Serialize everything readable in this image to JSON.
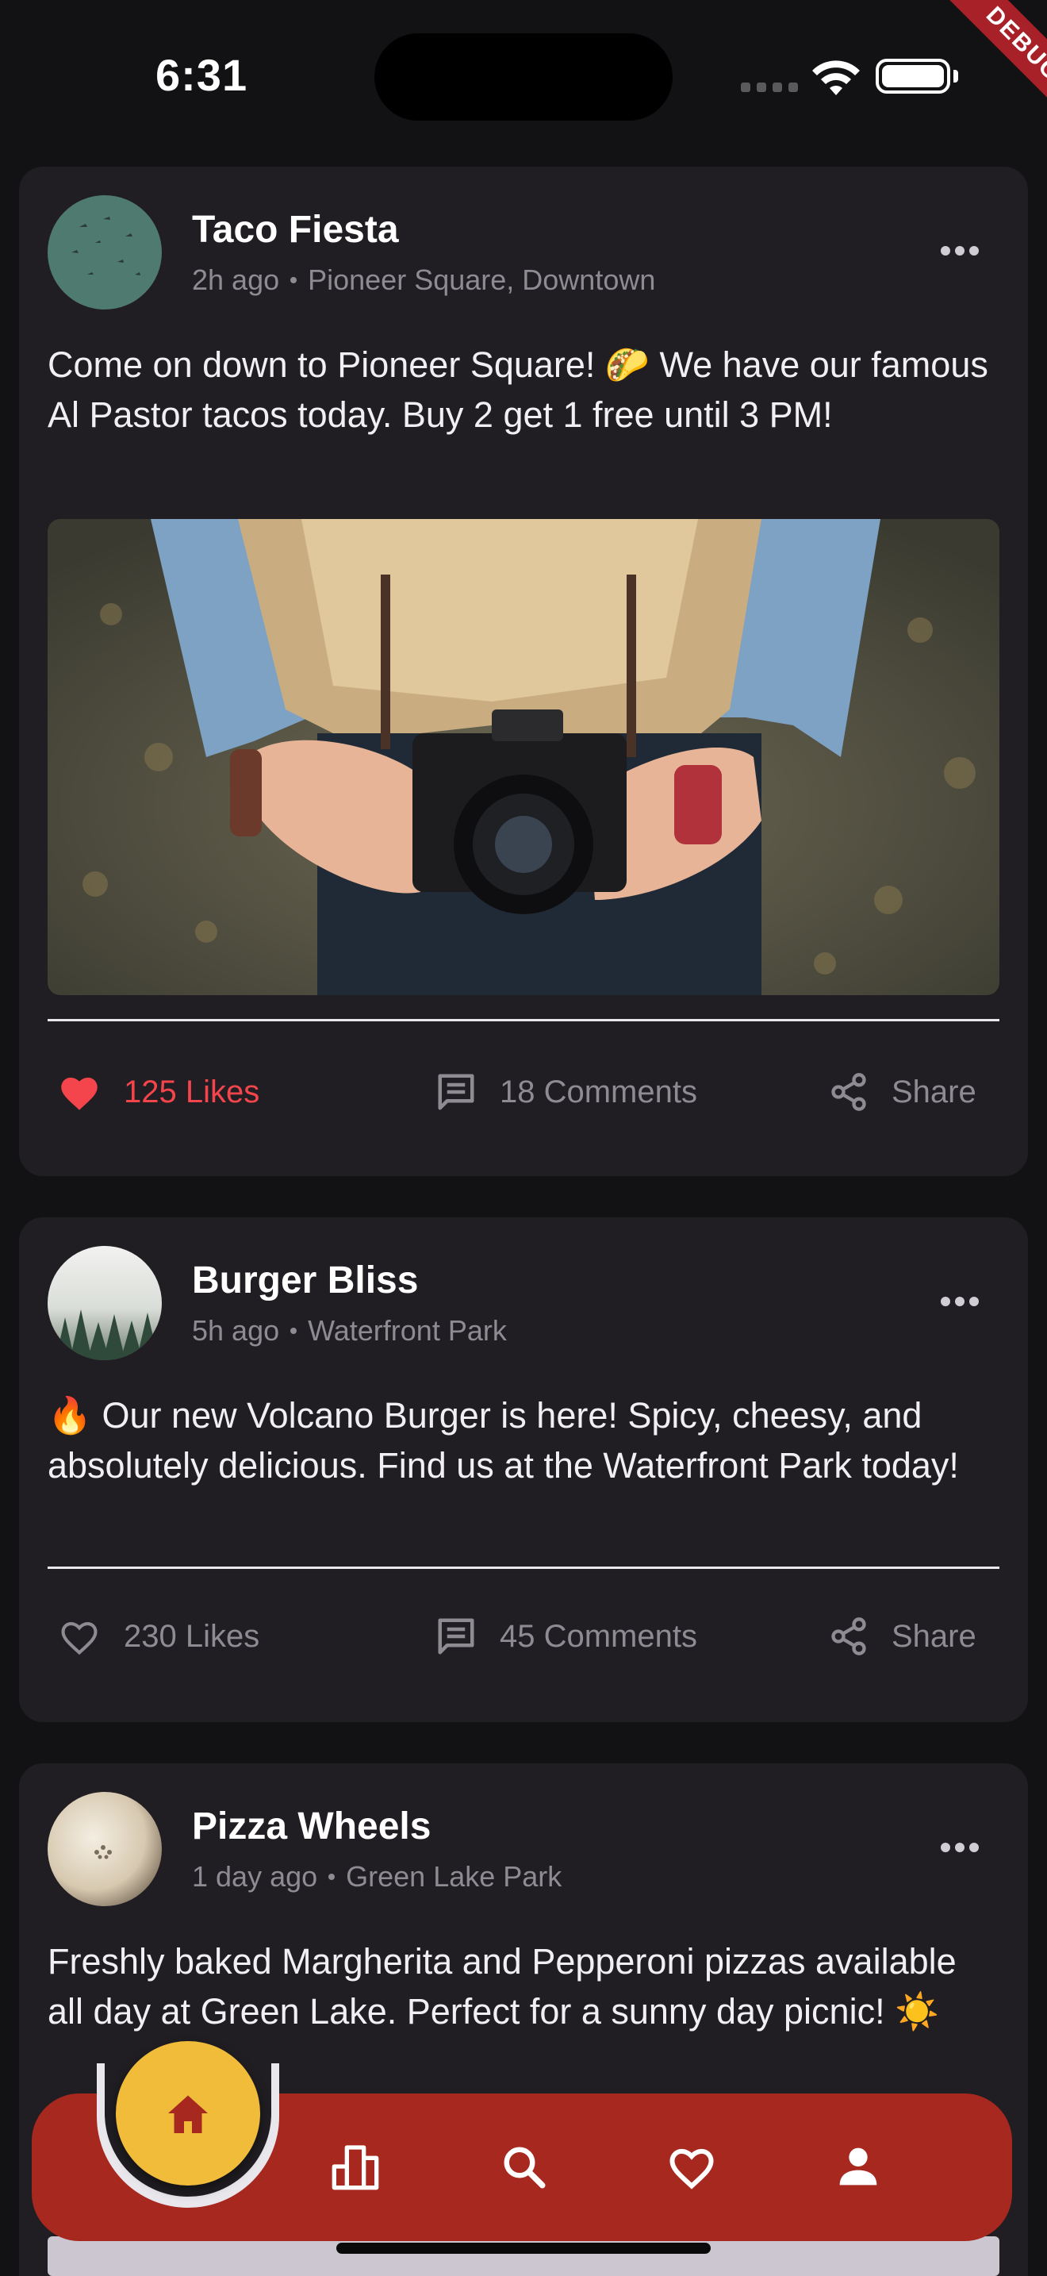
{
  "status_bar": {
    "time": "6:31",
    "debug_label": "DEBUG"
  },
  "colors": {
    "background": "#121113",
    "card": "#201e22",
    "accent_like": "#f4454c",
    "nav_bar": "#a7281f",
    "fab": "#f0bc3a",
    "muted_text": "#8e8b92"
  },
  "posts": [
    {
      "author": "Taco Fiesta",
      "time_ago": "2h ago",
      "location": "Pioneer Square, Downtown",
      "text": "Come on down to Pioneer Square! 🌮 We have our famous Al Pastor tacos today. Buy 2 get 1 free until 3 PM!",
      "has_image": true,
      "likes_label": "125 Likes",
      "liked": true,
      "comments_label": "18 Comments",
      "share_label": "Share"
    },
    {
      "author": "Burger Bliss",
      "time_ago": "5h ago",
      "location": "Waterfront Park",
      "text": "🔥 Our new Volcano Burger is here! Spicy, cheesy, and absolutely delicious. Find us at the Waterfront Park today!",
      "has_image": false,
      "likes_label": "230 Likes",
      "liked": false,
      "comments_label": "45 Comments",
      "share_label": "Share"
    },
    {
      "author": "Pizza Wheels",
      "time_ago": "1 day ago",
      "location": "Green Lake Park",
      "text": "Freshly baked Margherita and Pepperoni pizzas available all day at Green Lake. Perfect for a sunny day picnic! ☀️"
    }
  ],
  "bottom_nav": {
    "items": [
      "home-icon",
      "leaderboard-icon",
      "search-icon",
      "favorites-icon",
      "profile-icon"
    ],
    "active": "home-icon"
  }
}
